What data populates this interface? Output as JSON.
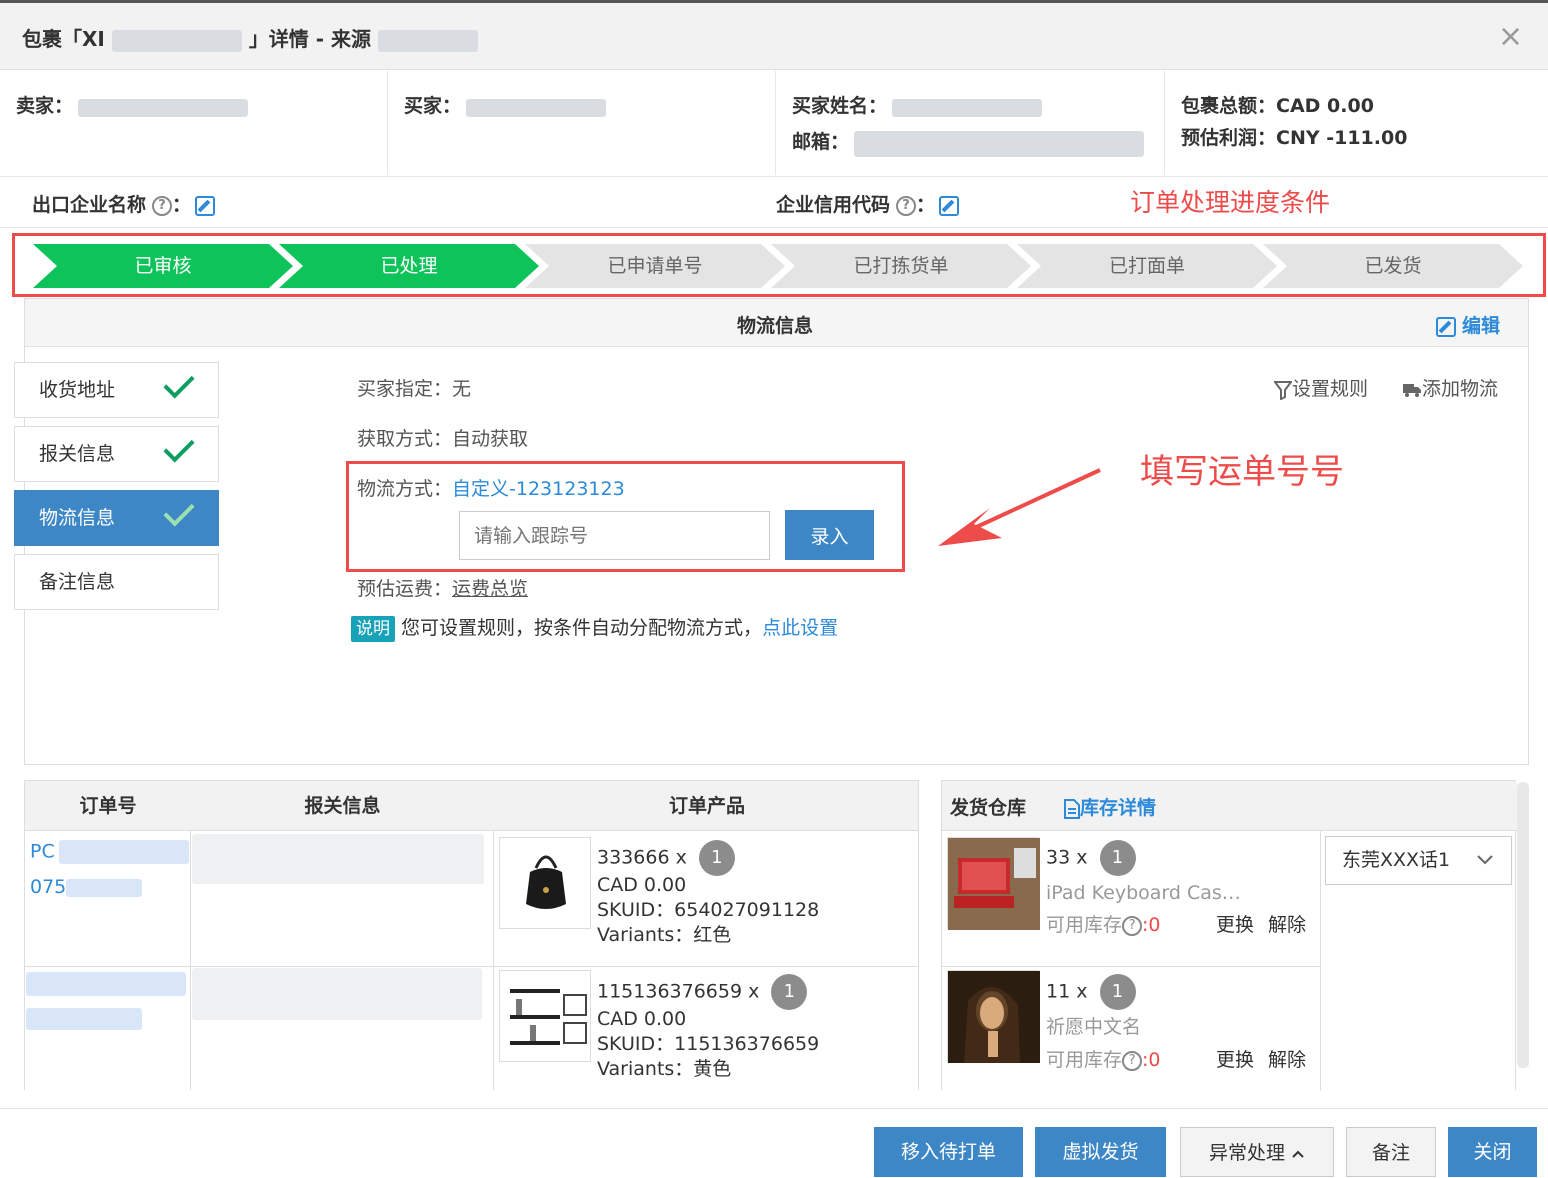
{
  "header": {
    "title_prefix": "包裹「XI",
    "title_mid": "」详情 - 来源",
    "close": "×"
  },
  "info": {
    "seller_label": "卖家：",
    "buyer_label": "买家：",
    "buyer_name_label": "买家姓名：",
    "email_label": "邮箱：",
    "package_total_label": "包裹总额：",
    "package_total_value": "CAD 0.00",
    "profit_label": "预估利润：",
    "profit_value": "CNY -111.00"
  },
  "company": {
    "export_name_label": "出口企业名称",
    "credit_code_label": "企业信用代码",
    "colon": "："
  },
  "annotations": {
    "progress_note": "订单处理进度条件",
    "tracking_note": "填写运单号号"
  },
  "progress": [
    {
      "label": "已审核",
      "done": true
    },
    {
      "label": "已处理",
      "done": true
    },
    {
      "label": "已申请单号",
      "done": false
    },
    {
      "label": "已打拣货单",
      "done": false
    },
    {
      "label": "已打面单",
      "done": false
    },
    {
      "label": "已发货",
      "done": false
    }
  ],
  "logistics": {
    "title": "物流信息",
    "edit": "编辑",
    "buyer_specified_label": "买家指定：",
    "buyer_specified_value": "无",
    "fetch_label": "获取方式：",
    "fetch_value": "自动获取",
    "method_label": "物流方式：",
    "method_value": "自定义-123123123",
    "tracking_placeholder": "请输入跟踪号",
    "enter_button": "录入",
    "fee_label": "预估运费：",
    "fee_link": "运费总览",
    "note_badge": "说明",
    "note_text": "您可设置规则，按条件自动分配物流方式，",
    "note_link": "点此设置",
    "set_rule": "设置规则",
    "add_logistics": "添加物流"
  },
  "tabs": [
    {
      "label": "收货地址",
      "checked": true
    },
    {
      "label": "报关信息",
      "checked": true
    },
    {
      "label": "物流信息",
      "checked": true
    },
    {
      "label": "备注信息",
      "checked": false
    }
  ],
  "table": {
    "headers": [
      "订单号",
      "报关信息",
      "订单产品"
    ],
    "rows": [
      {
        "order_prefix": "PC",
        "order_line2": "075",
        "sku": "333666",
        "x": "x",
        "qty": "1",
        "price": "CAD 0.00",
        "skuid": "SKUID：654027091128",
        "variants": "Variants：红色"
      },
      {
        "order_prefix": "",
        "order_line2": "",
        "sku": "115136376659",
        "x": "x",
        "qty": "1",
        "price": "CAD 0.00",
        "skuid": "SKUID：115136376659",
        "variants": "Variants：黄色"
      }
    ]
  },
  "warehouse": {
    "header": "发货仓库",
    "stock_detail": "库存详情",
    "selected": "东莞XXX话1",
    "items": [
      {
        "sku": "33",
        "x": "x",
        "qty": "1",
        "name": "iPad Keyboard Cas…",
        "stock_label": "可用库存",
        "stock_value": ":0",
        "replace": "更换",
        "release": "解除"
      },
      {
        "sku": "11",
        "x": "x",
        "qty": "1",
        "name": "祈愿中文名",
        "stock_label": "可用库存",
        "stock_value": ":0",
        "replace": "更换",
        "release": "解除"
      }
    ]
  },
  "footer": {
    "move_to_print": "移入待打单",
    "virtual_ship": "虚拟发货",
    "exception": "异常处理",
    "remark": "备注",
    "close": "关闭"
  },
  "colors": {
    "accent": "#3d87c7",
    "done": "#0dc35a",
    "annotation": "#ee4b4b",
    "link": "#2d8ad9"
  }
}
